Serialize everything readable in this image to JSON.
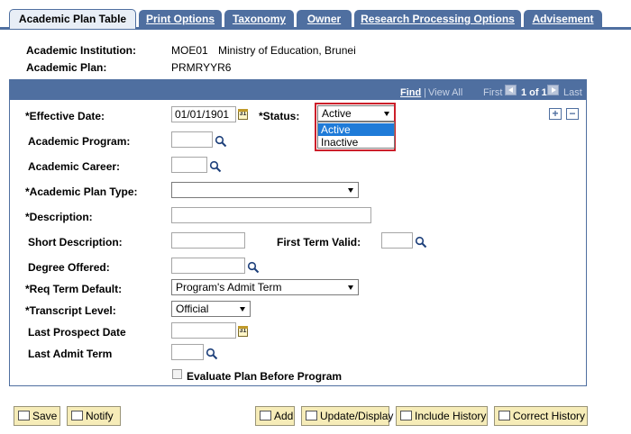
{
  "tabs": [
    {
      "label": "Academic Plan Table",
      "active": true
    },
    {
      "label": "Print Options",
      "active": false
    },
    {
      "label": "Taxonomy",
      "active": false
    },
    {
      "label": "Owner",
      "active": false
    },
    {
      "label": "Research Processing Options",
      "active": false
    },
    {
      "label": "Advisement",
      "active": false
    }
  ],
  "header": {
    "institution_label": "Academic Institution:",
    "institution_code": "MOE01",
    "institution_name": "Ministry of Education, Brunei",
    "plan_label": "Academic Plan:",
    "plan_value": "PRMRYYR6"
  },
  "nav": {
    "find": "Find",
    "separator": "|",
    "view_all": "View All",
    "first": "First",
    "count": "1 of 1",
    "last": "Last"
  },
  "form": {
    "effective_date_label": "*Effective Date:",
    "effective_date_value": "01/01/1901",
    "status_label": "*Status:",
    "status_value": "Active",
    "status_options": [
      "Active",
      "Inactive"
    ],
    "academic_program_label": "Academic Program:",
    "academic_career_label": "Academic Career:",
    "plan_type_label": "*Academic Plan Type:",
    "description_label": "*Description:",
    "short_description_label": "Short Description:",
    "first_term_valid_label": "First Term Valid:",
    "degree_offered_label": "Degree Offered:",
    "req_term_default_label": "*Req Term Default:",
    "req_term_default_value": "Program's Admit Term",
    "transcript_level_label": "*Transcript Level:",
    "transcript_level_value": "Official",
    "last_prospect_date_label": "Last Prospect Date",
    "last_admit_term_label": "Last Admit Term",
    "evaluate_plan_label": "Evaluate Plan Before Program",
    "calendar_icon_text": "31"
  },
  "buttons": {
    "save": "Save",
    "notify": "Notify",
    "add": "Add",
    "update_display": "Update/Display",
    "include_history": "Include History",
    "correct_history": "Correct History"
  },
  "colors": {
    "tab_blue": "#4f6fa0",
    "highlight_red": "#cc1f2a",
    "selection_blue": "#1f7bd8",
    "button_yellow": "#f6ecb8"
  }
}
